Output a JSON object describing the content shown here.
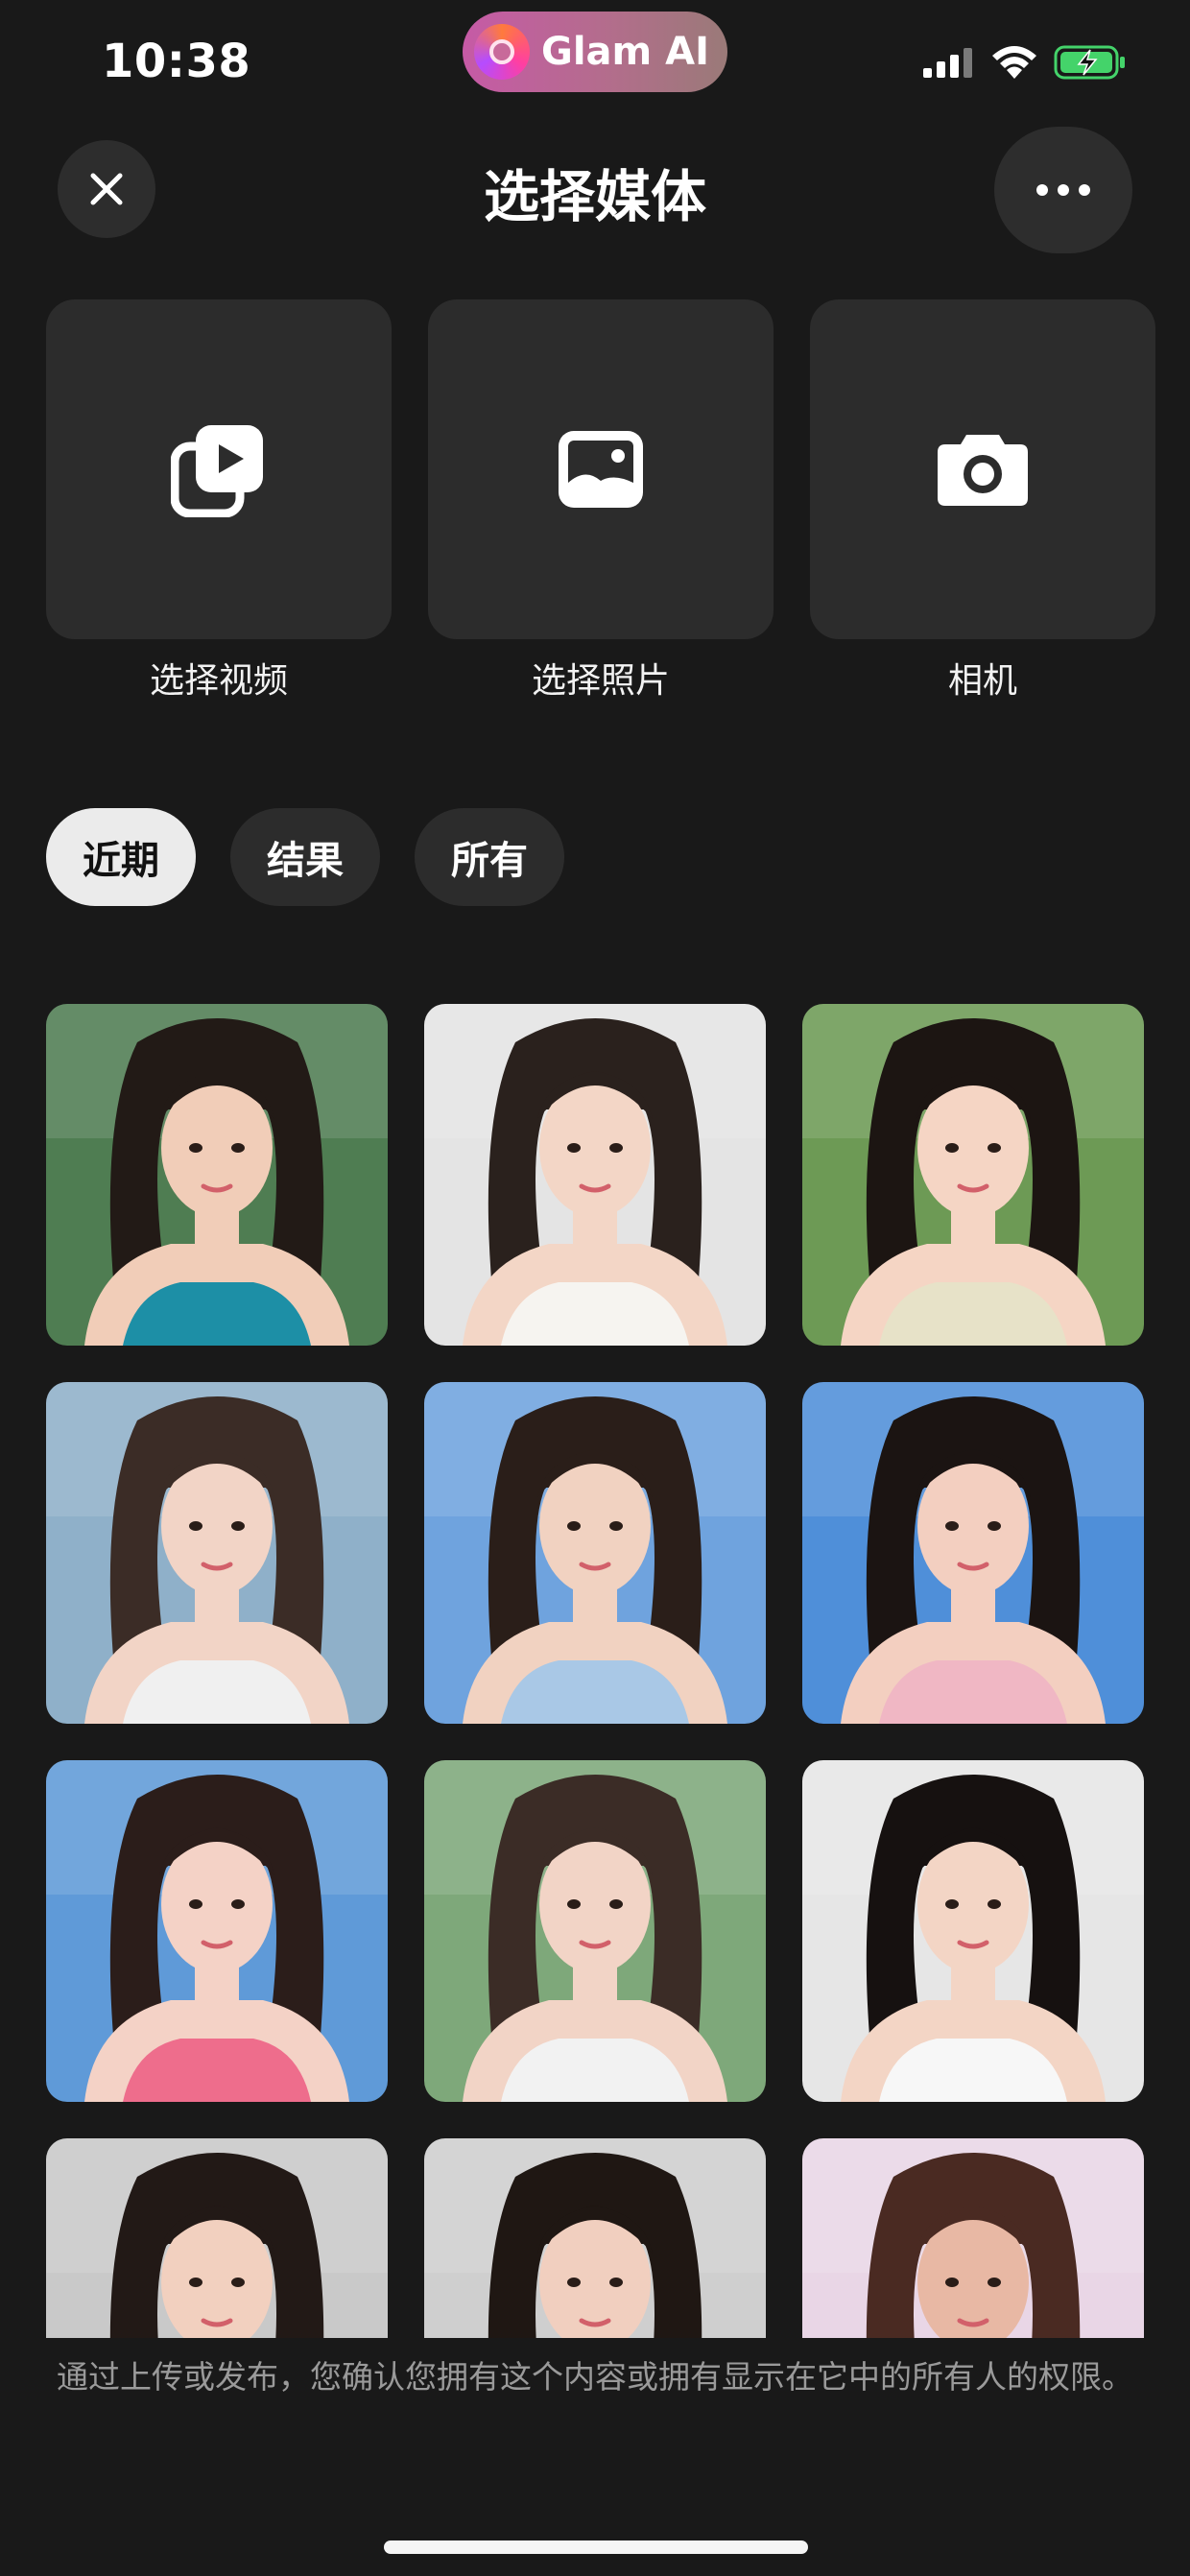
{
  "status_bar": {
    "time": "10:38",
    "app_pill": "Glam AI"
  },
  "header": {
    "title": "选择媒体"
  },
  "sources": [
    {
      "label": "选择视频",
      "icon": "video-icon"
    },
    {
      "label": "选择照片",
      "icon": "photo-icon"
    },
    {
      "label": "相机",
      "icon": "camera-icon"
    }
  ],
  "filters": [
    {
      "label": "近期",
      "active": true
    },
    {
      "label": "结果",
      "active": false
    },
    {
      "label": "所有",
      "active": false
    }
  ],
  "photos": [
    {
      "bg": "#4f7d52",
      "skin": "#f1cdb8",
      "hair": "#221a16",
      "cloth": "#1d8fa6"
    },
    {
      "bg": "#e4e4e4",
      "skin": "#f3d6c6",
      "hair": "#2a211d",
      "cloth": "#f6f4f0"
    },
    {
      "bg": "#6d9a55",
      "skin": "#f5d5c4",
      "hair": "#1c1512",
      "cloth": "#e7e2c8"
    },
    {
      "bg": "#8fb0c9",
      "skin": "#f2d4c6",
      "hair": "#3b2c26",
      "cloth": "#f0f0f0"
    },
    {
      "bg": "#6fa3de",
      "skin": "#f1d2c1",
      "hair": "#2a1e19",
      "cloth": "#a9c8e6"
    },
    {
      "bg": "#4f8fd9",
      "skin": "#f3cfc0",
      "hair": "#1b1412",
      "cloth": "#f0b7c4"
    },
    {
      "bg": "#5f9ad8",
      "skin": "#f4d2c6",
      "hair": "#2b1d1a",
      "cloth": "#ee6d8c"
    },
    {
      "bg": "#7ea87a",
      "skin": "#f2d4c6",
      "hair": "#3b2c26",
      "cloth": "#f2f2f2"
    },
    {
      "bg": "#e6e6e6",
      "skin": "#f3d5c5",
      "hair": "#161110",
      "cloth": "#f7f7f7"
    },
    {
      "bg": "#c9c9c9",
      "skin": "#f2d0bf",
      "hair": "#221916",
      "cloth": "#f7f7f7"
    },
    {
      "bg": "#cfcfcf",
      "skin": "#f1cfbf",
      "hair": "#1f1713",
      "cloth": "#f2ede4"
    },
    {
      "bg": "#e9d6e6",
      "skin": "#e8b8a4",
      "hair": "#4a2a22",
      "cloth": "#c8a7c8"
    }
  ],
  "notice": "通过上传或发布，您确认您拥有这个内容或拥有显示在它中的所有人的权限。"
}
